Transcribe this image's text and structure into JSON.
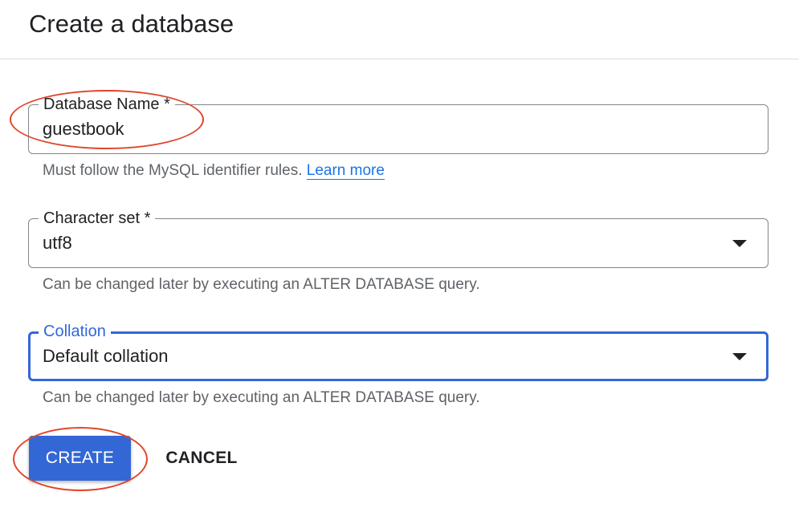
{
  "header": {
    "title": "Create a database"
  },
  "form": {
    "database_name": {
      "label": "Database Name *",
      "value": "guestbook",
      "hint": "Must follow the MySQL identifier rules.",
      "hint_link": "Learn more"
    },
    "character_set": {
      "label": "Character set *",
      "value": "utf8",
      "hint": "Can be changed later by executing an ALTER DATABASE query.",
      "icon": "dropdown-arrow-icon"
    },
    "collation": {
      "label": "Collation",
      "value": "Default collation",
      "hint": "Can be changed later by executing an ALTER DATABASE query.",
      "icon": "dropdown-arrow-icon",
      "state": "focused"
    }
  },
  "actions": {
    "create_label": "CREATE",
    "cancel_label": "CANCEL"
  },
  "colors": {
    "accent": "#3367d6",
    "link": "#1a73e8",
    "annotation": "#e0452b",
    "hint_text": "#5f6368"
  }
}
